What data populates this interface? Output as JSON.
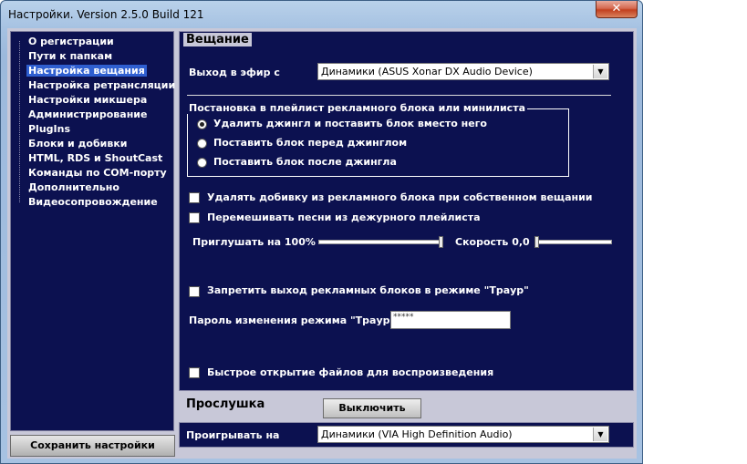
{
  "window": {
    "title": "Настройки. Version 2.5.0 Build 121",
    "close_label": "✕"
  },
  "sidebar": {
    "items": [
      {
        "label": "О регистрации"
      },
      {
        "label": "Пути к папкам"
      },
      {
        "label": "Настройка вещания",
        "selected": true
      },
      {
        "label": "Настройка ретрансляции"
      },
      {
        "label": "Настройки микшера"
      },
      {
        "label": "Администрирование"
      },
      {
        "label": "PlugIns"
      },
      {
        "label": "Блоки и добивки"
      },
      {
        "label": "HTML, RDS и ShoutCast"
      },
      {
        "label": "Команды по COM-порту"
      },
      {
        "label": "Дополнительно"
      },
      {
        "label": "Видеосопровождение"
      }
    ],
    "save_label": "Сохранить настройки"
  },
  "broadcast": {
    "title": "Вещание",
    "output_label": "Выход в эфир с",
    "output_value": "Динамики (ASUS Xonar DX Audio Device)",
    "group_title": "Постановка в плейлист рекламного блока или минилиста",
    "radios": [
      {
        "label": "Удалить джингл и поставить блок вместо него",
        "checked": true
      },
      {
        "label": "Поставить блок перед джинглом",
        "checked": false
      },
      {
        "label": "Поставить блок после джингла",
        "checked": false
      }
    ],
    "checkbox_remove_filler": "Удалять добивку из рекламного блока при собственном вещании",
    "checkbox_shuffle": "Перемешивать песни из дежурного плейлиста",
    "mute_label": "Приглушать на 100%",
    "mute_level": 1.0,
    "speed_label": "Скорость 0,0",
    "speed_level": 0.0,
    "checkbox_mourning": "Запретить выход рекламных блоков в режиме \"Траур\"",
    "password_label": "Пароль изменения режима \"Траур\"",
    "password_value": "*****",
    "checkbox_fast_open": "Быстрое открытие файлов для воспроизведения"
  },
  "listen": {
    "title": "Прослушка",
    "off_label": "Выключить",
    "play_label": "Проигрывать на",
    "play_value": "Динамики (VIA High Definition Audio)"
  },
  "colors": {
    "panel": "#0c1150",
    "selection": "#2f5fd0",
    "chrome": "#c8c8d8"
  },
  "icons": {
    "close": "close-icon",
    "dropdown": "chevron-down-icon"
  }
}
